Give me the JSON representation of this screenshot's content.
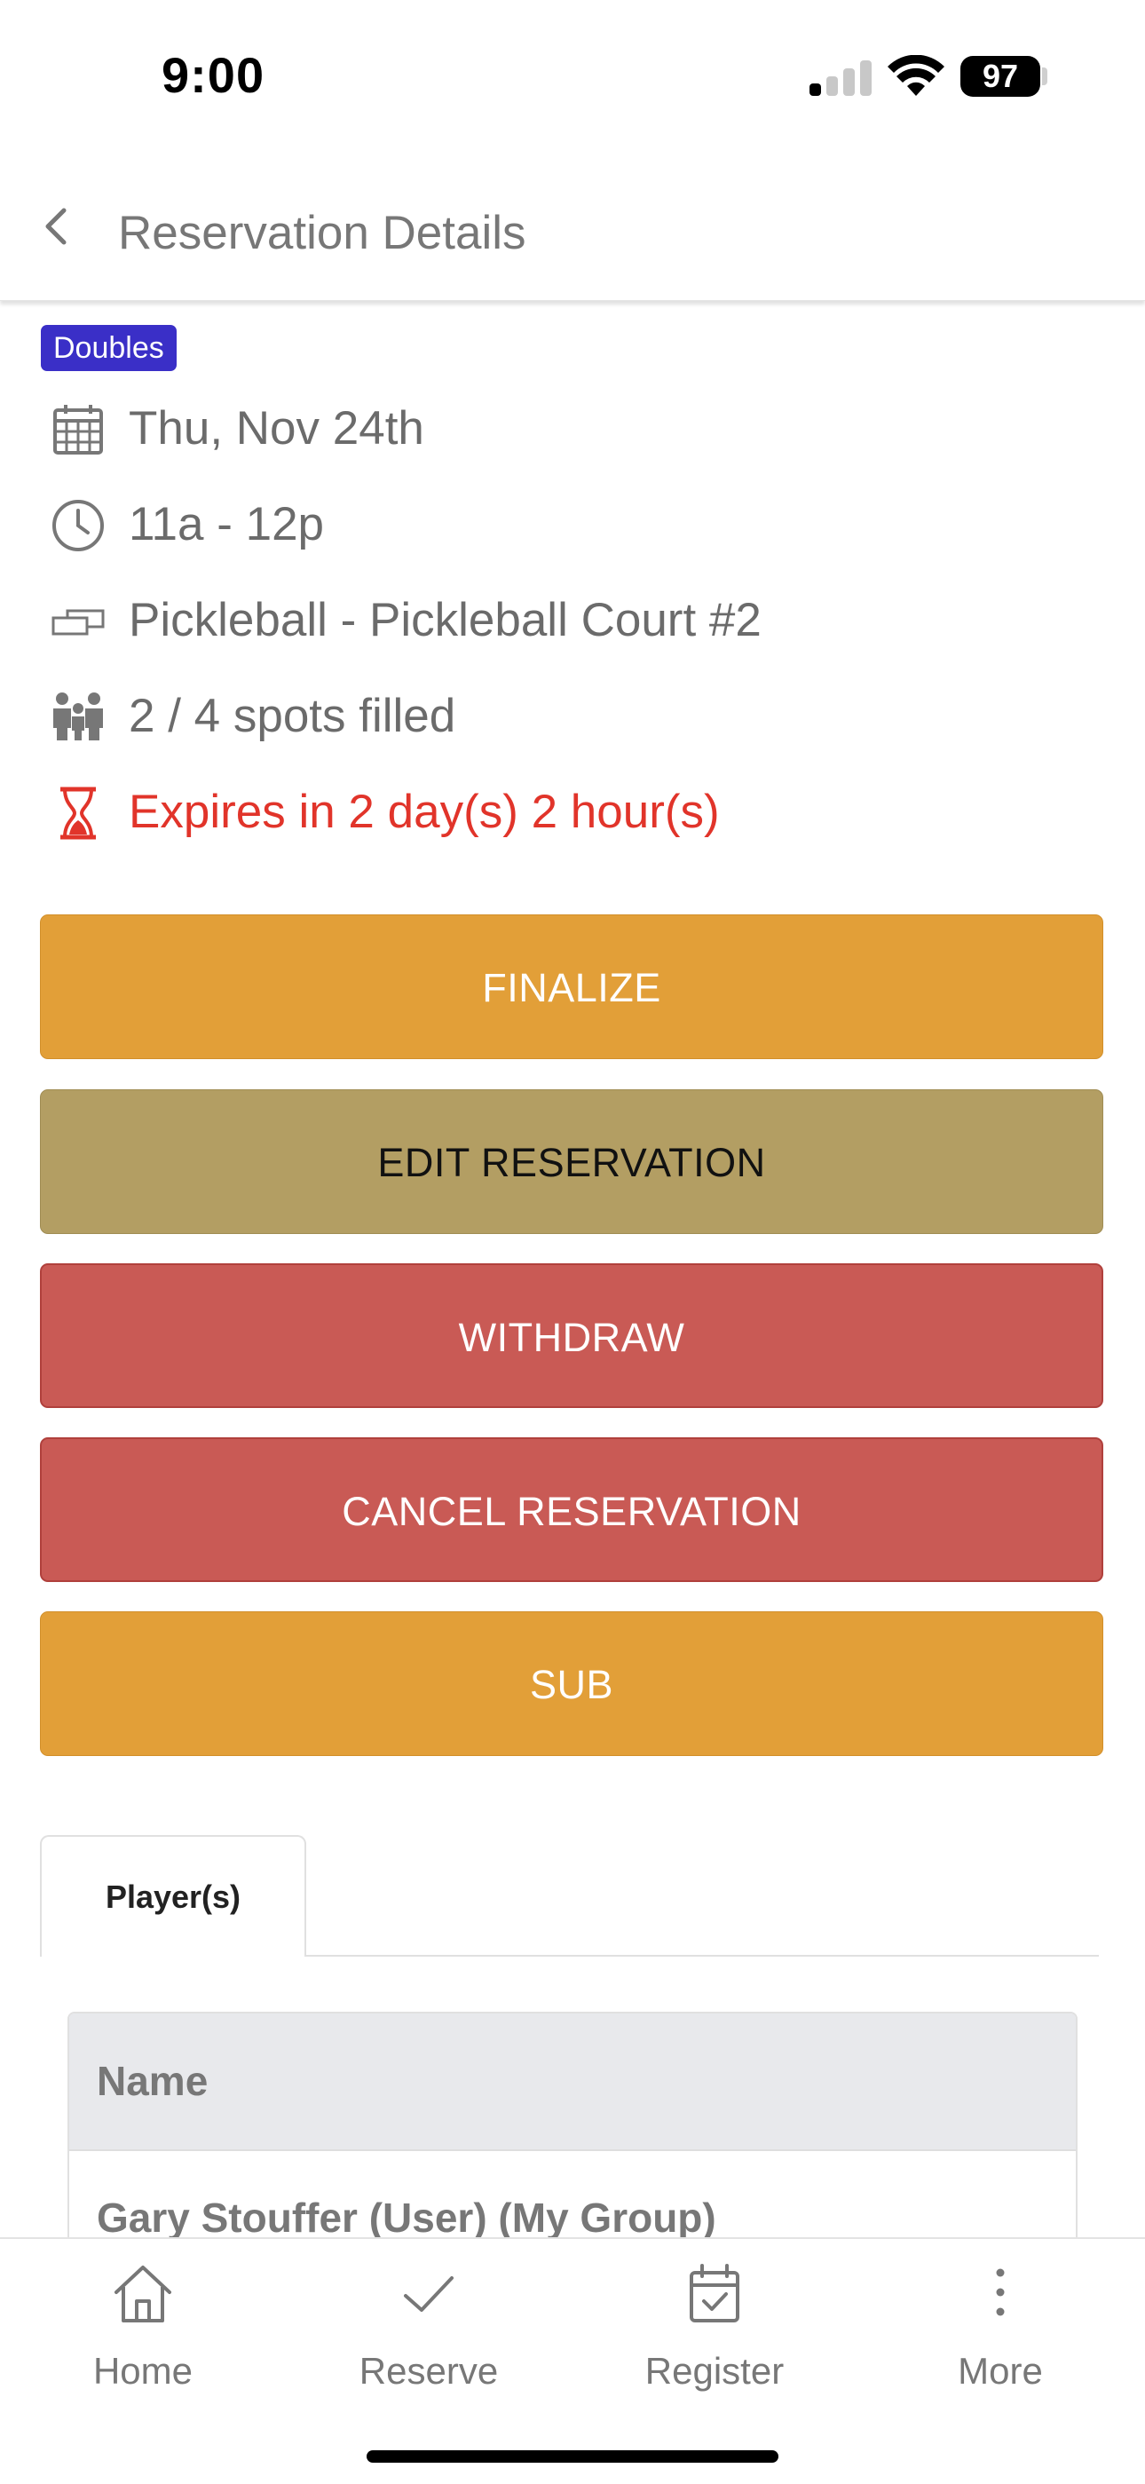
{
  "status_bar": {
    "time": "9:00",
    "battery": "97"
  },
  "nav": {
    "title": "Reservation Details"
  },
  "reservation": {
    "badge": "Doubles",
    "date": "Thu, Nov 24th",
    "time": "11a - 12p",
    "court": "Pickleball - Pickleball Court #2",
    "spots": "2 / 4 spots filled",
    "expires": "Expires in 2 day(s) 2 hour(s)"
  },
  "actions": {
    "finalize": "FINALIZE",
    "edit": "EDIT RESERVATION",
    "withdraw": "WITHDRAW",
    "cancel": "CANCEL RESERVATION",
    "sub": "SUB"
  },
  "colors": {
    "orange": "#e29f38",
    "olive": "#b39e63",
    "red": "#c95a55",
    "badge": "#3a2fc7",
    "expires": "#e1342a"
  },
  "tabs": [
    {
      "label": "Player(s)"
    }
  ],
  "players_table": {
    "header": "Name",
    "rows": [
      "Gary Stouffer (User) (My Group)"
    ]
  },
  "tabbar": {
    "items": [
      {
        "label": "Home",
        "icon": "home-icon"
      },
      {
        "label": "Reserve",
        "icon": "checkmark-icon"
      },
      {
        "label": "Register",
        "icon": "calendar-check-icon"
      },
      {
        "label": "More",
        "icon": "more-vertical-icon"
      }
    ]
  }
}
